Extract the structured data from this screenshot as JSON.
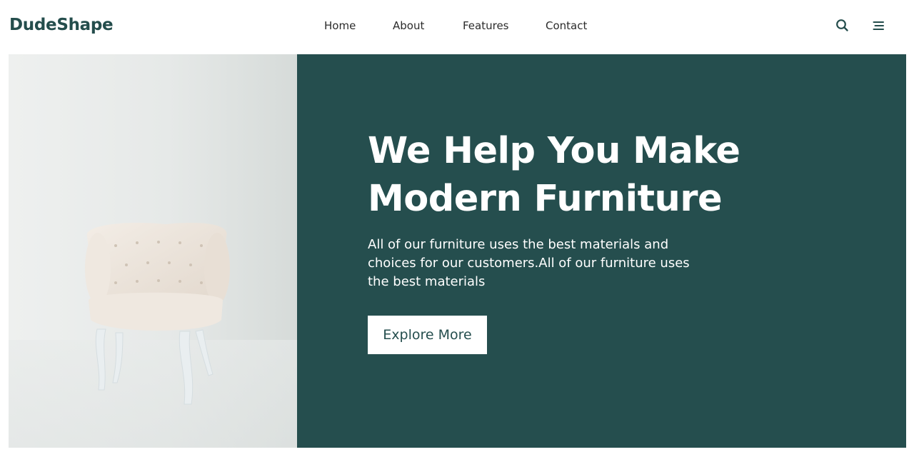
{
  "brand": {
    "name": "DudeShape"
  },
  "nav": {
    "items": [
      {
        "label": "Home"
      },
      {
        "label": "About"
      },
      {
        "label": "Features"
      },
      {
        "label": "Contact"
      }
    ]
  },
  "header_icons": [
    "search-icon",
    "menu-icon"
  ],
  "hero": {
    "title": "We Help You Make Modern Furniture",
    "description": "All of our furniture uses the best materials and choices for our customers.All of our furniture uses the best materials",
    "button_label": "Explore More",
    "image": "armchair-photo"
  },
  "colors": {
    "brand": "#244d4c",
    "panel": "#254e4e",
    "text_on_panel": "#ffffff",
    "nav_text": "#2b2b2b"
  }
}
